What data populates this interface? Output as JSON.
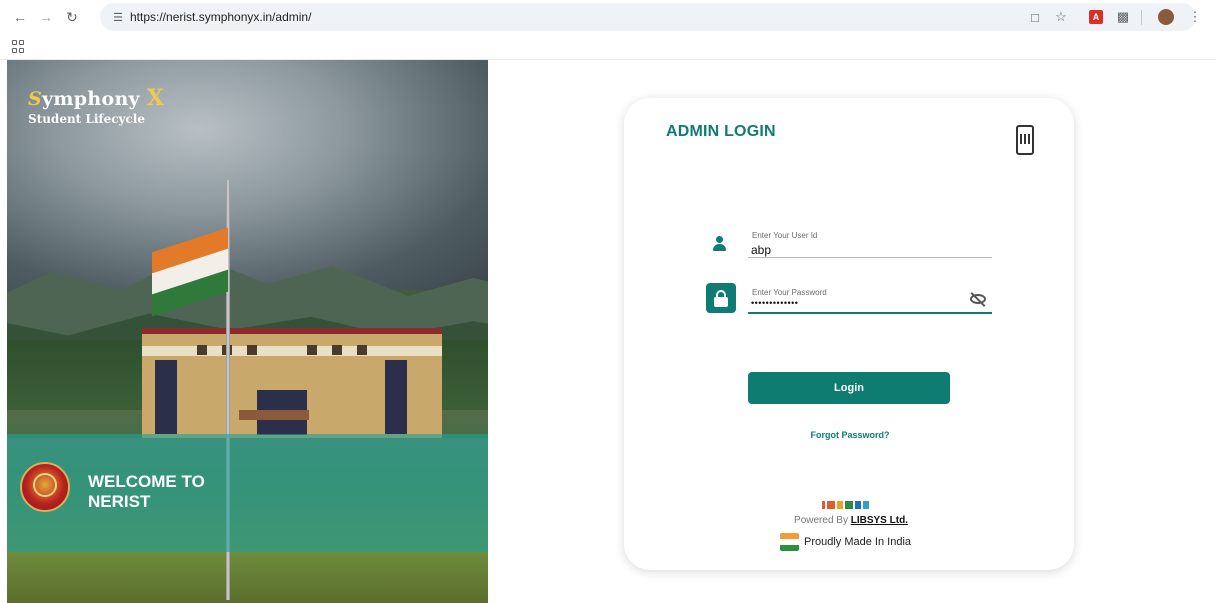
{
  "browser": {
    "url": "https://nerist.symphonyx.in/admin/"
  },
  "brand": {
    "title_prefix": "S",
    "title_main": "ymphony",
    "title_suffix": "X",
    "subtitle": "Student Lifecycle"
  },
  "welcome": {
    "line1": "WELCOME TO",
    "line2": "NERIST"
  },
  "login": {
    "title": "ADMIN LOGIN",
    "user_label": "Enter Your User Id",
    "user_value": "abp",
    "password_label": "Enter Your Password",
    "password_value": "•••••••••••••",
    "submit_label": "Login",
    "forgot_label": "Forgot Password?",
    "powered_prefix": "Powered By",
    "powered_company": "LIBSYS Ltd.",
    "made_in_india": "Proudly Made In India"
  },
  "colors": {
    "accent": "#0e7c75",
    "welcome_band": "#24a096"
  },
  "icons": [
    "back-icon",
    "forward-icon",
    "reload-icon",
    "site-info-icon",
    "cast-icon",
    "star-icon",
    "pdf-icon",
    "extensions-icon",
    "profile-avatar-icon",
    "menu-icon",
    "apps-icon",
    "qr-phone-icon",
    "user-icon",
    "lock-icon",
    "eye-off-icon",
    "india-flag-icon"
  ]
}
